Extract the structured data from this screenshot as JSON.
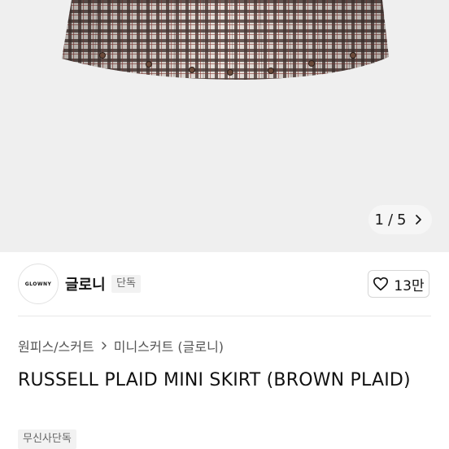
{
  "gallery": {
    "current": "1",
    "separator": "/",
    "total": "5",
    "image_icon": "plaid-skirt-image",
    "next_icon": "chevron-right-icon"
  },
  "seller": {
    "logo_text": "GLOWNY",
    "name": "글로니",
    "badge": "단독",
    "like_icon": "heart-outline-icon",
    "like_count": "13만"
  },
  "breadcrumb": {
    "items": [
      "원피스/스커트",
      "미니스커트 (글로니)"
    ],
    "separator_icon": "chevron-right-icon"
  },
  "product": {
    "title": "RUSSELL PLAID MINI SKIRT (BROWN PLAID)",
    "tag": "무신사단독"
  }
}
